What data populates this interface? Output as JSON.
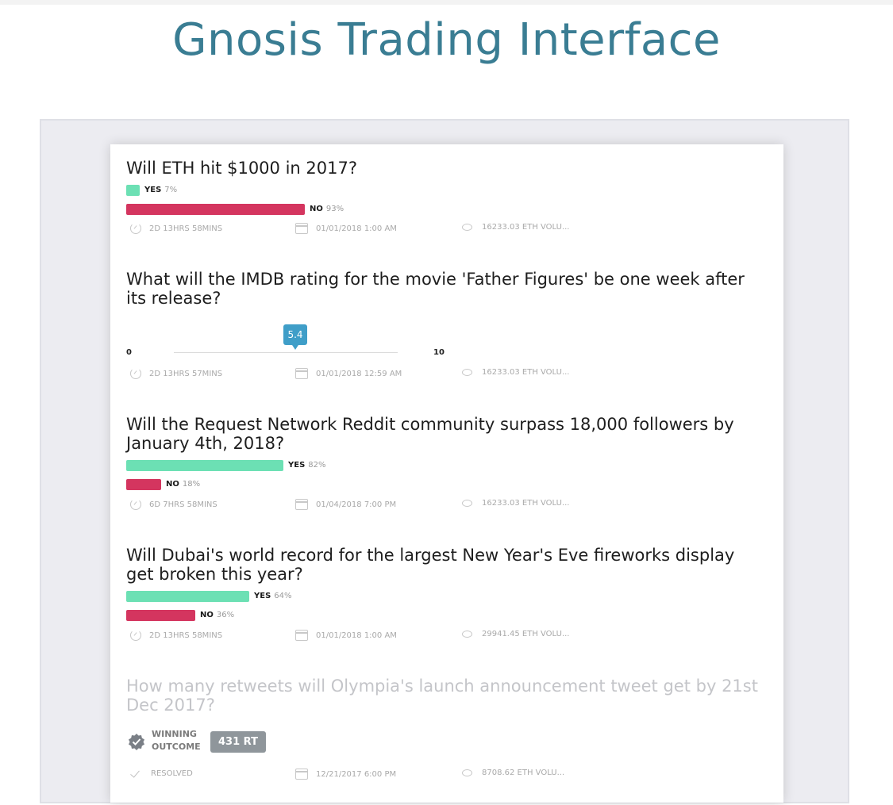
{
  "page": {
    "title": "Gnosis Trading Interface"
  },
  "markets": [
    {
      "question": "Will ETH hit $1000 in 2017?",
      "yes_label": "YES",
      "yes_pct": "7%",
      "yes_value": 0.07,
      "no_label": "NO",
      "no_pct": "93%",
      "no_value": 0.93,
      "time_left": "2D 13HRS 58MINS",
      "resolution_date": "01/01/2018 1:00 AM",
      "volume": "16233.03 ETH  VOLU..."
    },
    {
      "question": "What will the IMDB rating for the movie 'Father Figures' be one week after its release?",
      "scalar_min": "0",
      "scalar_max": "10",
      "scalar_value": "5.4",
      "time_left": "2D 13HRS 57MINS",
      "resolution_date": "01/01/2018 12:59 AM",
      "volume": "16233.03 ETH  VOLU..."
    },
    {
      "question": "Will the Request Network Reddit community surpass 18,000 followers by January 4th, 2018?",
      "yes_label": "YES",
      "yes_pct": "82%",
      "yes_value": 0.82,
      "no_label": "NO",
      "no_pct": "18%",
      "no_value": 0.18,
      "time_left": "6D 7HRS 58MINS",
      "resolution_date": "01/04/2018 7:00 PM",
      "volume": "16233.03 ETH  VOLU..."
    },
    {
      "question": "Will Dubai's world record for the largest New Year's Eve fireworks display get broken this year?",
      "yes_label": "YES",
      "yes_pct": "64%",
      "yes_value": 0.64,
      "no_label": "NO",
      "no_pct": "36%",
      "no_value": 0.36,
      "time_left": "2D 13HRS 58MINS",
      "resolution_date": "01/01/2018 1:00 AM",
      "volume": "29941.45 ETH  VOLU..."
    },
    {
      "question": "How many retweets will Olympia's launch announcement tweet get by 21st Dec 2017?",
      "winning_label_1": "WINNING",
      "winning_label_2": "OUTCOME",
      "winning_outcome": "431 RT",
      "status": "RESOLVED",
      "resolution_date": "12/21/2017 6:00 PM",
      "volume": "8708.62 ETH  VOLU..."
    }
  ]
}
